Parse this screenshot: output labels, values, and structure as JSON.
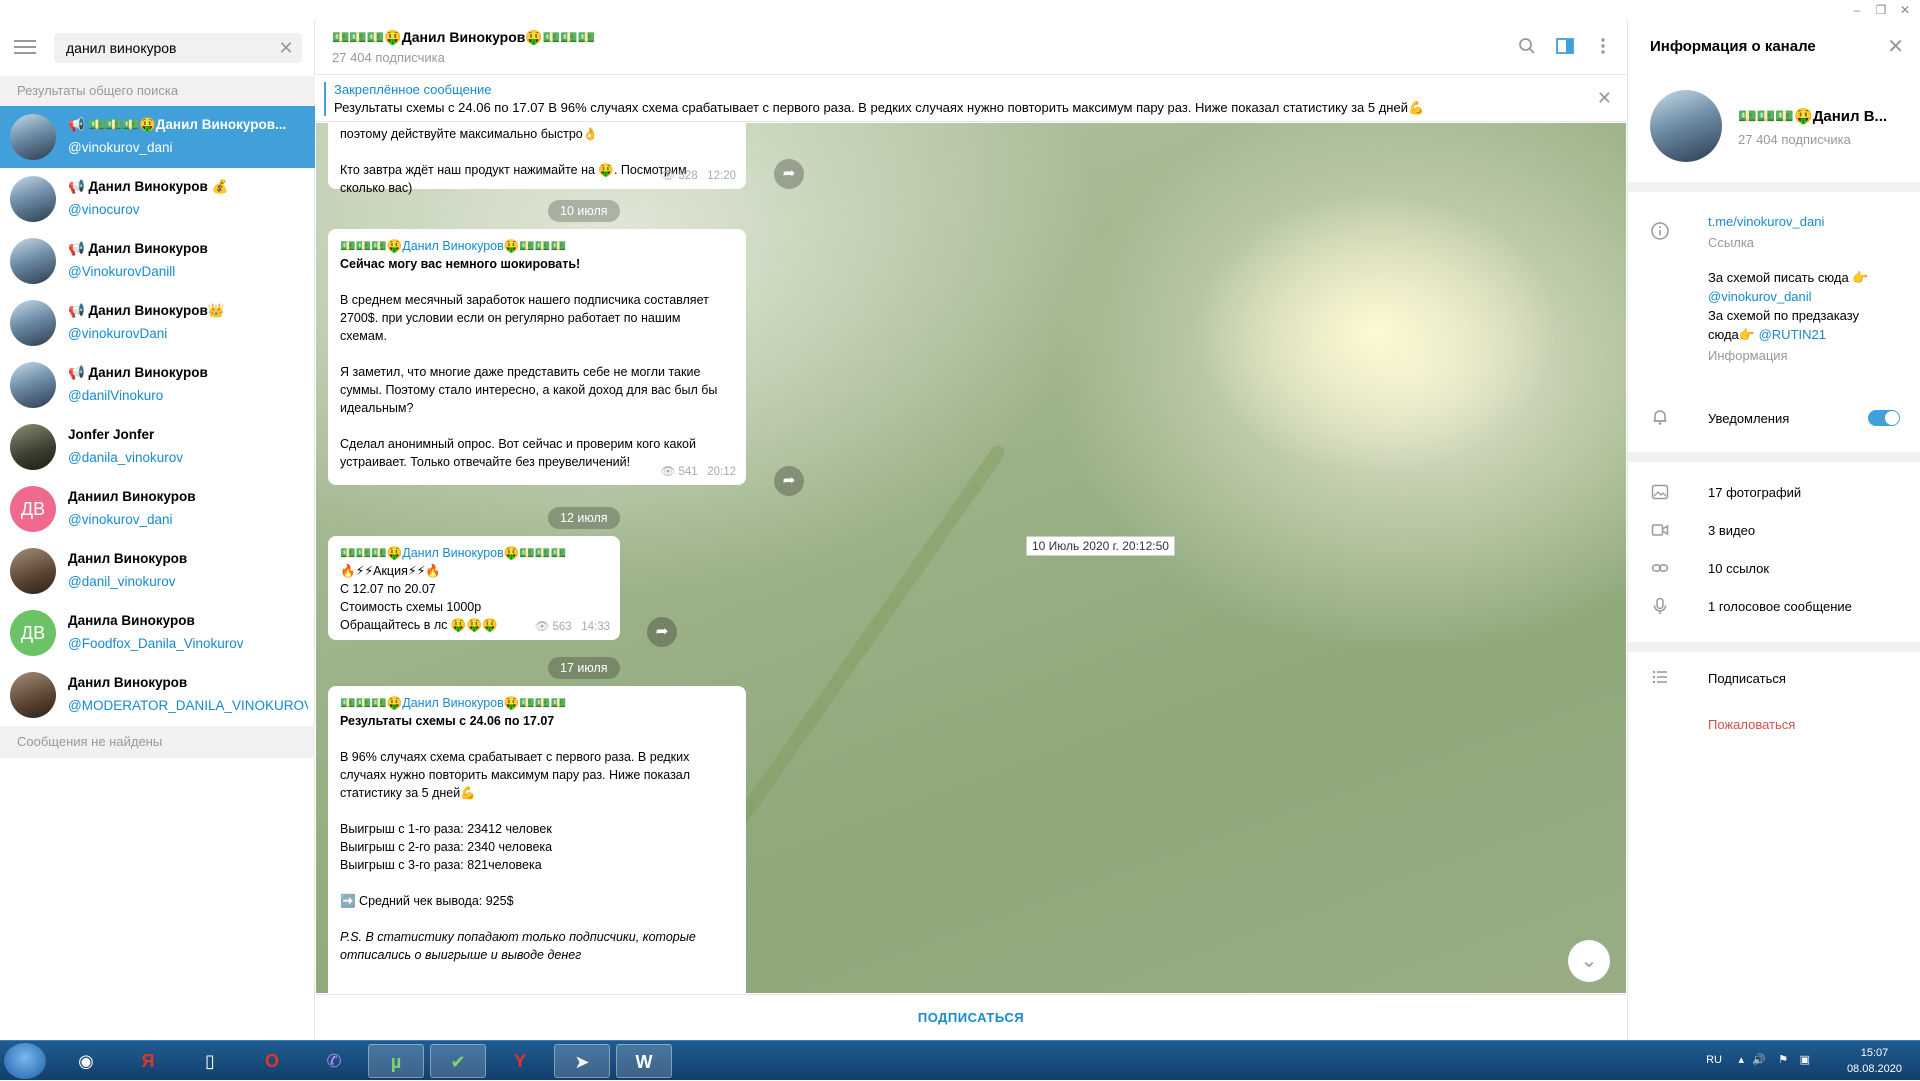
{
  "search": {
    "value": "данил винокуров",
    "section_header": "Результаты общего поиска",
    "not_found": "Сообщения не найдены"
  },
  "results": [
    {
      "name": "📢 💵💵💵🤑Данил Винокуров...",
      "handle": "@vinokurov_dani"
    },
    {
      "name": "📢 Данил Винокуров 💰",
      "handle": "@vinocurov"
    },
    {
      "name": "📢 Данил Винокуров",
      "handle": "@VinokurovDanill"
    },
    {
      "name": "📢 Данил Винокуров👑",
      "handle": "@vinokurovDani"
    },
    {
      "name": "📢 Данил Винокуров",
      "handle": "@danilVinokuro"
    },
    {
      "name": "Jonfer Jonfer",
      "handle": "@danila_vinokurov"
    },
    {
      "name": "Даниил Винокуров",
      "handle": "@vinokurov_dani",
      "initials": "ДВ"
    },
    {
      "name": "Данил Винокуров",
      "handle": "@danil_vinokurov"
    },
    {
      "name": "Данила Винокуров",
      "handle": "@Foodfox_Danila_Vinokurov",
      "initials": "ДВ"
    },
    {
      "name": "Данил Винокуров",
      "handle": "@MODERATOR_DANILA_VINOKUROV"
    }
  ],
  "chat": {
    "title": "💵💵💵🤑Данил Винокуров🤑💵💵💵",
    "subscribers": "27 404 подписчика",
    "pinned_title": "Закреплённое сообщение",
    "pinned_text": "Результаты схемы с 24.06  по 17.07   В 96% случаях схема срабатывает с первого раза. В редких случаях нужно повторить максимум пару раз. Ниже показал статистику за 5 дней💪",
    "subscribe_button": "ПОДПИСАТЬСЯ"
  },
  "messages": {
    "m1": {
      "l1": "поэтому действуйте максимально быстро👌",
      "l2": "Кто завтра ждёт наш продукт нажимайте на 🤑. Посмотрим",
      "l3": "сколько вас)",
      "views": "528",
      "time": "12:20"
    },
    "date1": "10 июля",
    "m2": {
      "author": "💵💵💵🤑Данил Винокуров🤑💵💵💵",
      "bold": "Сейчас могу вас немного шокировать!",
      "p1a": "В среднем месячный заработок нашего подписчика составляет",
      "p1b": "2700$. при условии если он регулярно работает по нашим",
      "p1c": "схемам.",
      "p2a": "Я заметил, что многие даже представить себе не могли такие",
      "p2b": "суммы. Поэтому стало интересно, а какой доход для вас был бы",
      "p2c": "идеальным?",
      "p3a": "Сделал анонимный опрос. Вот сейчас и проверим кого какой",
      "p3b": "устраивает. Только отвечайте без преувеличений!",
      "views": "541",
      "time": "20:12"
    },
    "tooltip": "10 Июль 2020 г. 20:12:50",
    "date2": "12 июля",
    "m3": {
      "author": "💵💵💵🤑Данил Винокуров🤑💵💵💵",
      "l1": "🔥⚡⚡Акция⚡⚡🔥",
      "l2": "С 12.07 по 20.07",
      "l3": "Стоимость схемы 1000р",
      "l4": "Обращайтесь в лс 🤑🤑🤑",
      "views": "563",
      "time": "14:33"
    },
    "date3": "17 июля",
    "m4": {
      "author": "💵💵💵🤑Данил Винокуров🤑💵💵💵",
      "bold": "Результаты схемы с 24.06  по 17.07",
      "p1a": "В 96% случаях схема срабатывает с первого раза. В редких",
      "p1b": "случаях нужно повторить максимум пару раз. Ниже показал",
      "p1c": "статистику за 5 дней💪",
      "w1": "Выигрыш с 1-го раза: 23412 человек",
      "w2": "Выигрыш с 2-го раза: 2340 человека",
      "w3": "Выигрыш с 3-го раза: 821человека",
      "avg": "➡️ Средний чек вывода: 925$",
      "ps1": "P.S. В статистику попадают только подписчики, которые",
      "ps2": "отписались о выигрыше и выводе денег"
    }
  },
  "info": {
    "header": "Информация о канале",
    "name": "💵💵💵🤑Данил В...",
    "subscribers": "27 404 подписчика",
    "link": "t.me/vinokurov_dani",
    "link_label": "Ссылка",
    "desc1": "За схемой писать сюда 👉",
    "desc2": "@vinokurov_danil",
    "desc3": "За схемой по предзаказу",
    "desc4a": "сюда👉",
    "desc4b": "@RUTIN21",
    "desc_label": "Информация",
    "notifications": "Уведомления",
    "photos": "17 фотографий",
    "videos": "3 видео",
    "links": "10 ссылок",
    "voice": "1 голосовое сообщение",
    "subscribe": "Подписаться",
    "report": "Пожаловаться"
  },
  "taskbar": {
    "lang": "RU",
    "time": "15:07",
    "date": "08.08.2020"
  }
}
